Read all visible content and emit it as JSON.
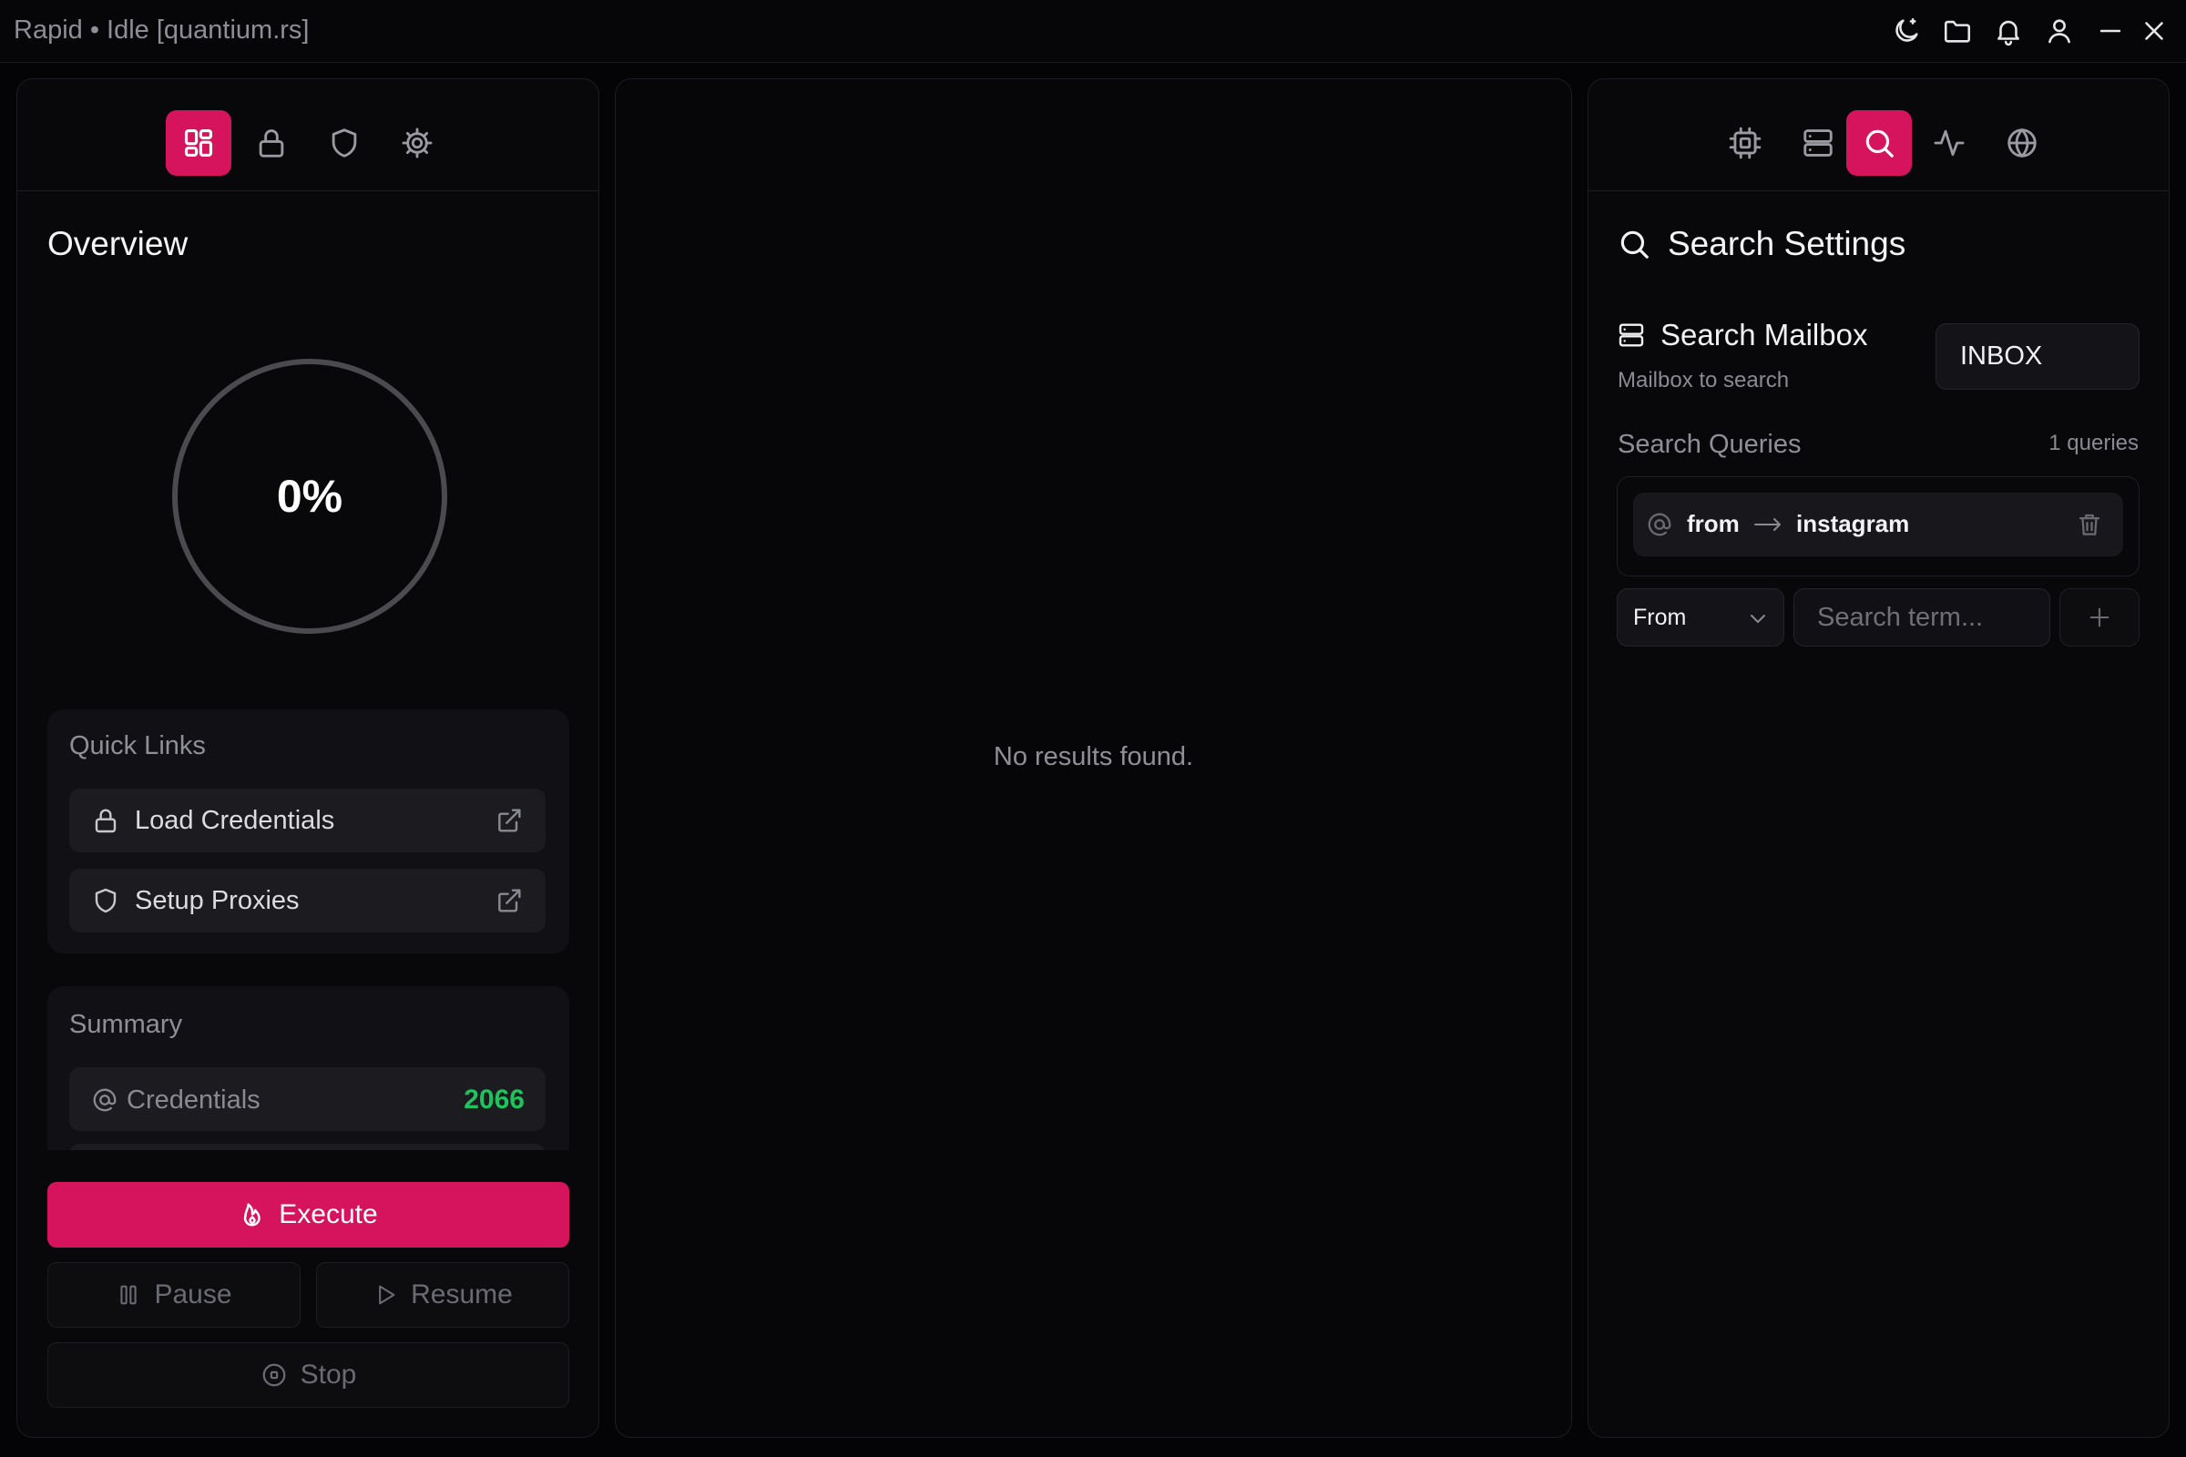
{
  "window": {
    "title": "Rapid • Idle [quantium.rs]",
    "controls": [
      "moon-icon",
      "folder-icon",
      "bell-icon",
      "user-icon",
      "minimize-icon",
      "close-icon"
    ]
  },
  "left_panel": {
    "tabs": [
      {
        "icon": "dashboard-icon",
        "active": true
      },
      {
        "icon": "lock-icon",
        "active": false
      },
      {
        "icon": "shield-icon",
        "active": false
      },
      {
        "icon": "gear-icon",
        "active": false
      }
    ],
    "title": "Overview",
    "progress": {
      "percent": 0,
      "label": "0%"
    },
    "quick_links": {
      "title": "Quick Links",
      "items": [
        {
          "label": "Load Credentials",
          "icon": "lock-icon"
        },
        {
          "label": "Setup Proxies",
          "icon": "shield-icon"
        }
      ]
    },
    "summary": {
      "title": "Summary",
      "items": [
        {
          "label": "Credentials",
          "value": "2066",
          "icon": "at-icon"
        }
      ]
    },
    "buttons": {
      "execute": "Execute",
      "pause": "Pause",
      "resume": "Resume",
      "stop": "Stop"
    }
  },
  "middle_panel": {
    "empty_text": "No results found."
  },
  "right_panel": {
    "tabs": [
      {
        "icon": "cpu-icon",
        "active": false
      },
      {
        "icon": "server-icon",
        "active": false
      },
      {
        "icon": "search-icon",
        "active": true
      },
      {
        "icon": "activity-icon",
        "active": false
      },
      {
        "icon": "globe-icon",
        "active": false
      }
    ],
    "title": "Search Settings",
    "mailbox": {
      "label": "Search Mailbox",
      "sublabel": "Mailbox to search",
      "value": "INBOX"
    },
    "queries": {
      "title": "Search Queries",
      "count_label": "1 queries",
      "items": [
        {
          "field": "from",
          "value": "instagram"
        }
      ],
      "new_query": {
        "field_selected": "From",
        "placeholder": "Search term..."
      }
    }
  },
  "colors": {
    "accent": "#d6145e",
    "success": "#1fc25c",
    "background": "#040406",
    "panel": "#08080b"
  }
}
